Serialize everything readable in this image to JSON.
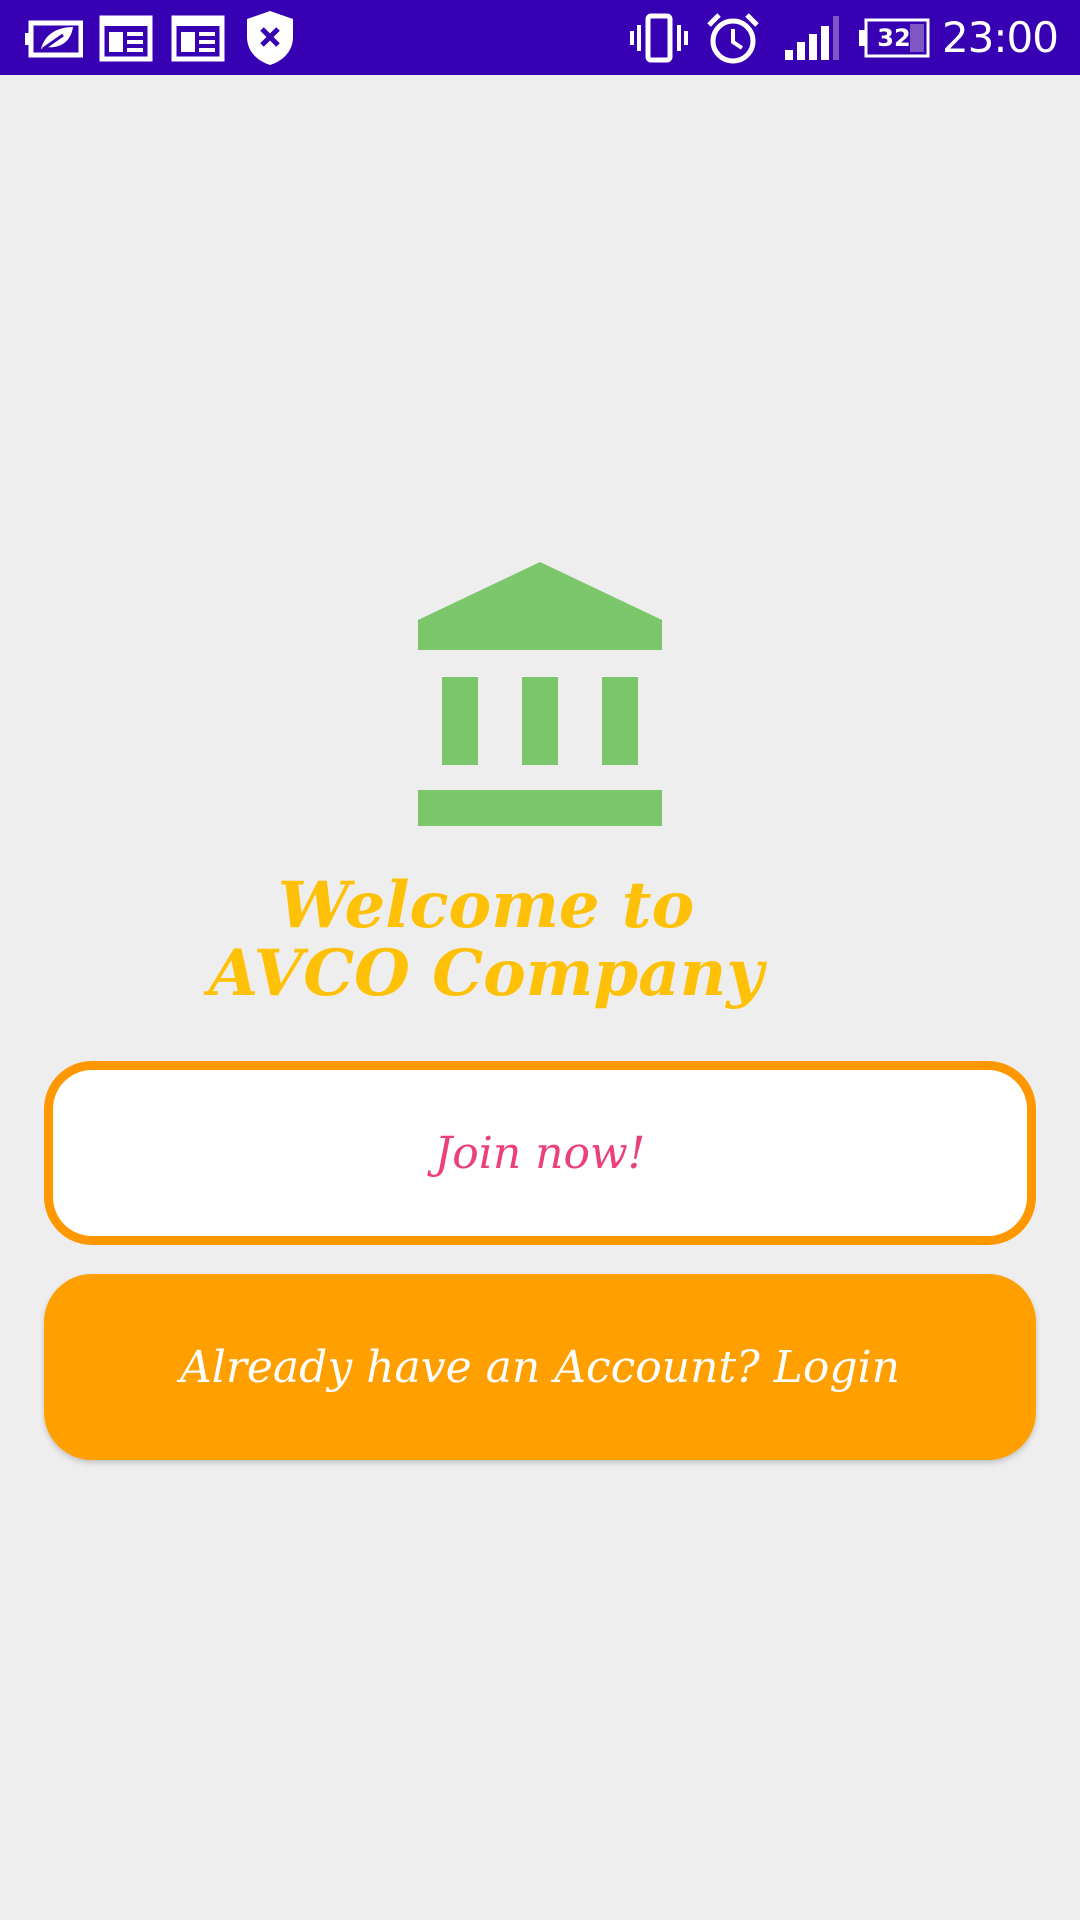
{
  "status_bar": {
    "time": "23:00",
    "battery_level": "32",
    "left_icons": [
      "leaf-battery-icon",
      "calendar-icon",
      "calendar-icon",
      "shield-x-icon"
    ],
    "right_icons": [
      "vibrate-icon",
      "alarm-icon",
      "signal-icon",
      "battery-icon"
    ],
    "background_color": "#3700b3"
  },
  "main": {
    "logo_icon": "bank-icon",
    "logo_color": "#7cc66b",
    "welcome_text": "Welcome to AVCO Company",
    "title_color": "#ffc107",
    "join_button_label": "Join now!",
    "join_button_border_color": "#ff9800",
    "join_button_text_color": "#ec407a",
    "login_button_label": "Already have an Account? Login",
    "login_button_color": "#ffa000"
  }
}
